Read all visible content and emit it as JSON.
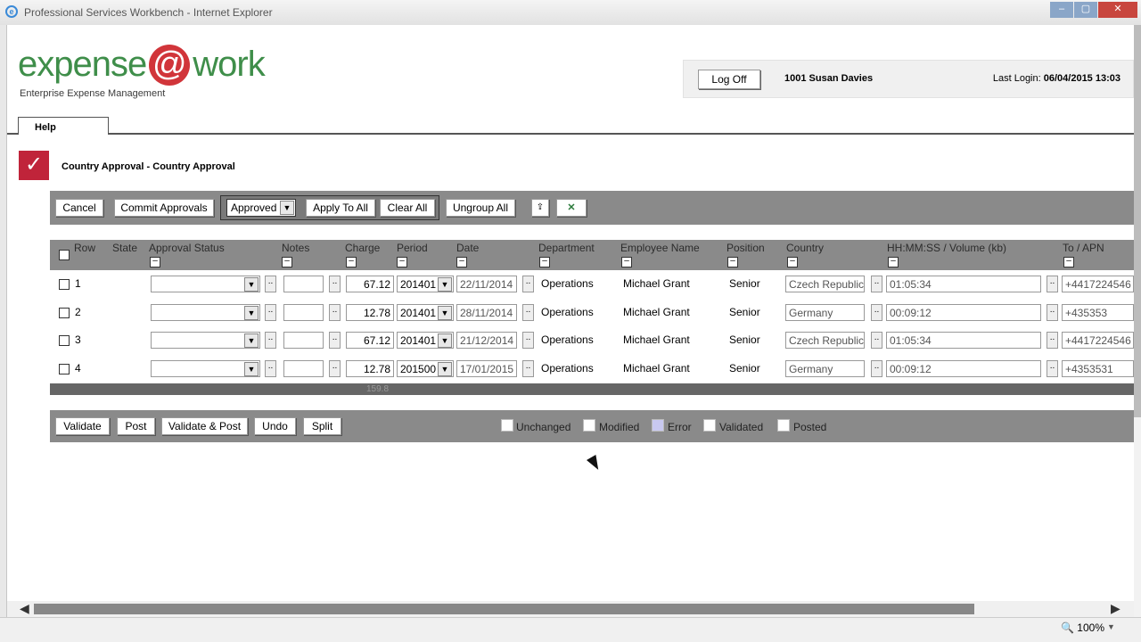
{
  "window": {
    "title": "Professional Services Workbench - Internet Explorer",
    "min": "–",
    "max": "▢",
    "close": "✕"
  },
  "header": {
    "logo_left": "expense",
    "logo_at": "@",
    "logo_right": "work",
    "tagline": "Enterprise Expense Management",
    "logoff_label": "Log Off",
    "user": "1001 Susan Davies",
    "last_login_label": "Last Login:",
    "last_login_value": "06/04/2015 13:03"
  },
  "tabs": [
    {
      "label": "Help"
    }
  ],
  "page": {
    "title": "Country Approval - Country Approval",
    "icon": "✓"
  },
  "toolbar": {
    "cancel": "Cancel",
    "commit": "Commit Approvals",
    "status_select": "Approved",
    "apply_all": "Apply To All",
    "clear_all": "Clear All",
    "ungroup": "Ungroup All",
    "pin_icon": "pin-icon",
    "excel_icon": "excel-icon"
  },
  "grid": {
    "columns": [
      "Row",
      "State",
      "Approval Status",
      "Notes",
      "Charge",
      "Period",
      "Date",
      "Department",
      "Employee Name",
      "Position",
      "Country",
      "HH:MM:SS / Volume (kb)",
      "To / APN"
    ],
    "rows": [
      {
        "row": "1",
        "approval": "",
        "notes": "",
        "charge": "67.12",
        "period": "201401",
        "date": "22/11/2014",
        "department": "Operations",
        "employee": "Michael Grant",
        "position": "Senior",
        "country": "Czech Republic",
        "duration": "01:05:34",
        "apn": "+4417224546"
      },
      {
        "row": "2",
        "approval": "",
        "notes": "",
        "charge": "12.78",
        "period": "201401",
        "date": "28/11/2014",
        "department": "Operations",
        "employee": "Michael Grant",
        "position": "Senior",
        "country": "Germany",
        "duration": "00:09:12",
        "apn": "+435353"
      },
      {
        "row": "3",
        "approval": "",
        "notes": "",
        "charge": "67.12",
        "period": "201401",
        "date": "21/12/2014",
        "department": "Operations",
        "employee": "Michael Grant",
        "position": "Senior",
        "country": "Czech Republic",
        "duration": "01:05:34",
        "apn": "+4417224546"
      },
      {
        "row": "4",
        "approval": "",
        "notes": "",
        "charge": "12.78",
        "period": "201500",
        "date": "17/01/2015",
        "department": "Operations",
        "employee": "Michael Grant",
        "position": "Senior",
        "country": "Germany",
        "duration": "00:09:12",
        "apn": "+4353531"
      }
    ],
    "total": "159.8"
  },
  "bottom": {
    "validate": "Validate",
    "post": "Post",
    "validate_post": "Validate & Post",
    "undo": "Undo",
    "split": "Split",
    "legend": [
      {
        "label": "Unchanged",
        "color": "#ffffff"
      },
      {
        "label": "Modified",
        "color": "#ffffff"
      },
      {
        "label": "Error",
        "color": "#c8c8f0"
      },
      {
        "label": "Validated",
        "color": "#ffffff"
      },
      {
        "label": "Posted",
        "color": "#ffffff"
      }
    ]
  },
  "status": {
    "zoom": "100%"
  },
  "colors": {
    "brand_green": "#3f8e4a",
    "brand_red": "#d1353a",
    "toolbar_grey": "#8a8a8a"
  }
}
